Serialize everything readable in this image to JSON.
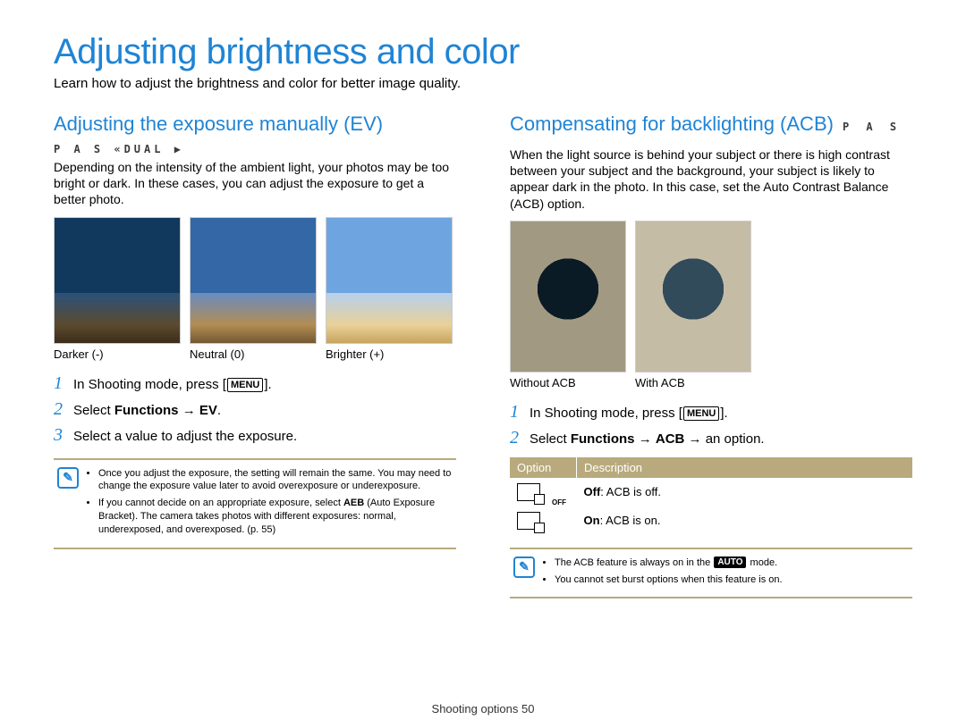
{
  "title": "Adjusting brightness and color",
  "subtitle": "Learn how to adjust the brightness and color for better image quality.",
  "left": {
    "heading": "Adjusting the exposure manually (EV)",
    "modes": "P A S «DUAL ▶",
    "intro": "Depending on the intensity of the ambient light, your photos may be too bright or dark. In these cases, you can adjust the exposure to get a better photo.",
    "thumbs": [
      {
        "caption": "Darker (-)"
      },
      {
        "caption": "Neutral (0)"
      },
      {
        "caption": "Brighter (+)"
      }
    ],
    "steps": {
      "s1_a": "In Shooting mode, press [",
      "menu": "MENU",
      "s1_b": "].",
      "s2_a": "Select ",
      "s2_b": "Functions",
      "s2_c": " → ",
      "s2_d": "EV",
      "s2_e": ".",
      "s3": "Select a value to adjust the exposure."
    },
    "notes": {
      "n1": "Once you adjust the exposure, the setting will remain the same. You may need to change the exposure value later to avoid overexposure or underexposure.",
      "n2_a": "If you cannot decide on an appropriate exposure, select ",
      "n2_b": "AEB",
      "n2_c": " (Auto Exposure Bracket). The camera takes photos with different exposures: normal, underexposed, and overexposed. (p. 55)"
    }
  },
  "right": {
    "heading": "Compensating for backlighting (ACB)",
    "modes": "P A S",
    "intro": "When the light source is behind your subject or there is high contrast between your subject and the background, your subject is likely to appear dark in the photo. In this case, set the Auto Contrast Balance (ACB) option.",
    "thumbs": [
      {
        "caption": "Without ACB"
      },
      {
        "caption": "With ACB"
      }
    ],
    "steps": {
      "s1_a": "In Shooting mode, press [",
      "menu": "MENU",
      "s1_b": "].",
      "s2_a": "Select ",
      "s2_b": "Functions",
      "s2_c": " → ",
      "s2_d": "ACB",
      "s2_e": " → an option."
    },
    "table": {
      "h1": "Option",
      "h2": "Description",
      "r1_b": "Off",
      "r1_c": ": ACB is off.",
      "r2_b": "On",
      "r2_c": ": ACB is on."
    },
    "notes": {
      "n1_a": "The ACB feature is always on in the ",
      "n1_auto": "AUTO",
      "n1_b": " mode.",
      "n2": "You cannot set burst options when this feature is on."
    }
  },
  "footer_a": "Shooting options  ",
  "footer_b": "50"
}
